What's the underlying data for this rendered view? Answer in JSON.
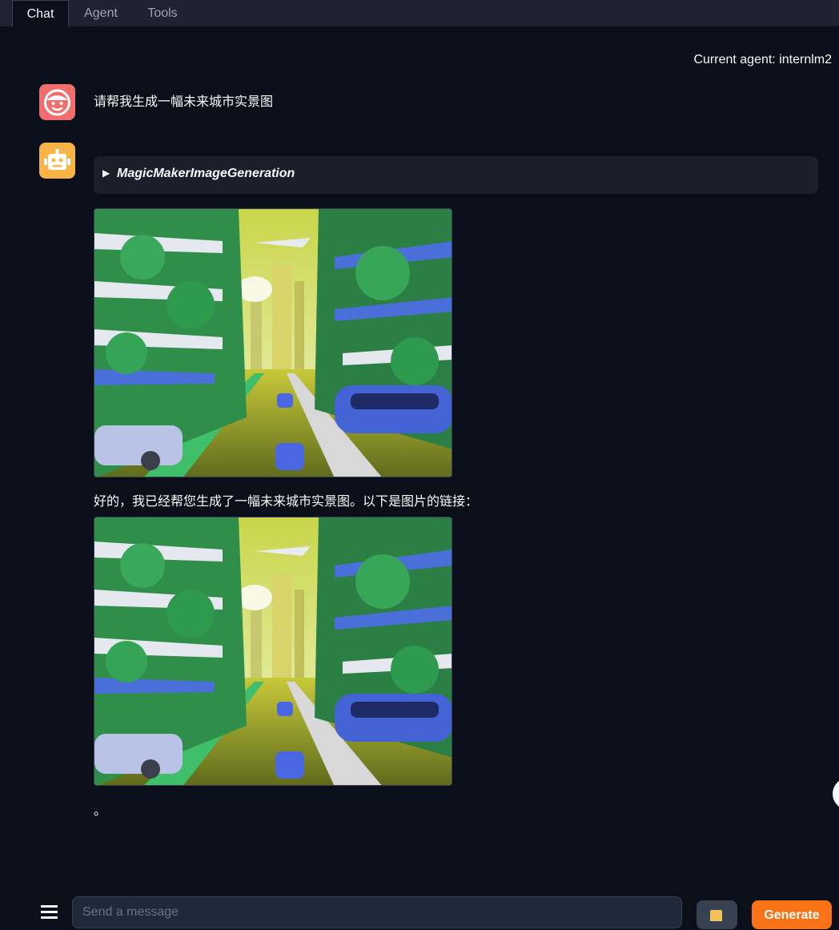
{
  "tabs": [
    {
      "label": "Chat",
      "active": true
    },
    {
      "label": "Agent",
      "active": false
    },
    {
      "label": "Tools",
      "active": false
    }
  ],
  "current_agent": "Current agent: internlm2",
  "conversation": {
    "user_message": "请帮我生成一幅未来城市实景图",
    "tool_call": {
      "caret": "▶",
      "name": "MagicMakerImageGeneration"
    },
    "assistant_reply": "好的，我已经帮您生成了一幅未来城市实景图。以下是图片的链接：",
    "trailing_text": "。"
  },
  "composer": {
    "placeholder": "Send a message",
    "generate_label": "Generate"
  },
  "colors": {
    "background": "#0b0f19",
    "user_avatar": "#f26d6d",
    "bot_avatar": "#f8b446",
    "generate_button": "#f97316"
  },
  "icons": [
    "user-face-icon",
    "robot-icon",
    "menu-icon",
    "folder-icon"
  ]
}
